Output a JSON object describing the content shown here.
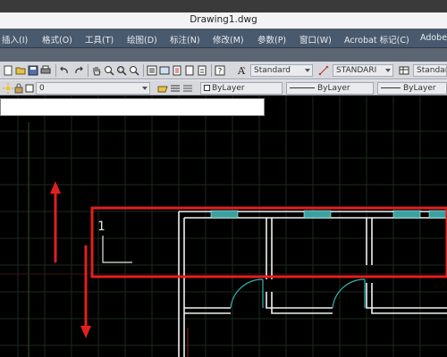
{
  "window": {
    "title": "Drawing1.dwg"
  },
  "menu": {
    "items": [
      {
        "label": "插入(I)"
      },
      {
        "label": "格式(O)"
      },
      {
        "label": "工具(T)"
      },
      {
        "label": "绘图(D)"
      },
      {
        "label": "标注(N)"
      },
      {
        "label": "修改(M)"
      },
      {
        "label": "参数(P)"
      },
      {
        "label": "窗口(W)"
      },
      {
        "label": "Acrobat 标记(C)"
      },
      {
        "label": "Adobe"
      }
    ]
  },
  "toolbar": {
    "text_style": "Standard",
    "dim_style": "STANDARI",
    "table_style": "Standard",
    "layer": "0",
    "color": "ByLayer",
    "linetype": "ByLayer",
    "lineweight": "ByLayer"
  },
  "canvas": {
    "ucs_label": "1",
    "colors": {
      "background": "#000000",
      "grid": "#1c2a1c",
      "highlight": "#e02020",
      "walls": "#ffffff",
      "windows": "#3aa0a0"
    }
  }
}
